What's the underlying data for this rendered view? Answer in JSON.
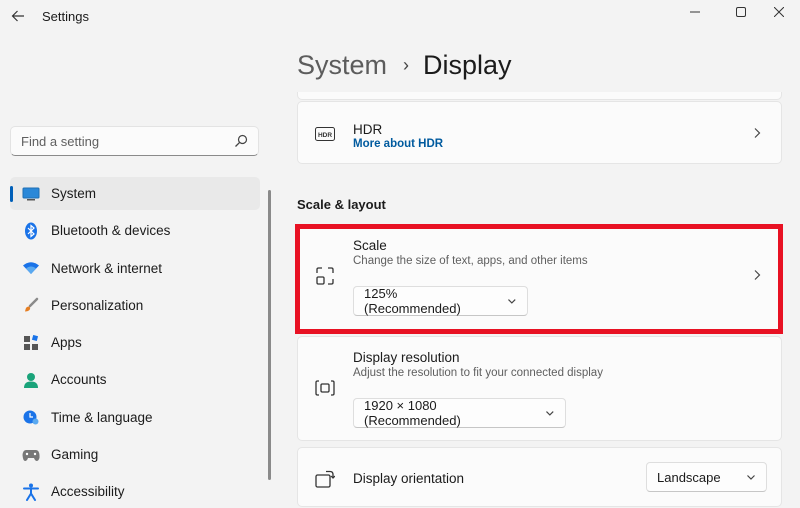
{
  "window": {
    "title": "Settings",
    "controls": {
      "minimize": "—",
      "maximize": "☐",
      "close": "✕"
    }
  },
  "search": {
    "placeholder": "Find a setting"
  },
  "sidebar": {
    "items": [
      {
        "label": "System",
        "icon": "monitor-icon",
        "active": true
      },
      {
        "label": "Bluetooth & devices",
        "icon": "bluetooth-icon"
      },
      {
        "label": "Network & internet",
        "icon": "wifi-icon"
      },
      {
        "label": "Personalization",
        "icon": "brush-icon"
      },
      {
        "label": "Apps",
        "icon": "apps-icon"
      },
      {
        "label": "Accounts",
        "icon": "person-icon"
      },
      {
        "label": "Time & language",
        "icon": "clock-globe-icon"
      },
      {
        "label": "Gaming",
        "icon": "gamepad-icon"
      },
      {
        "label": "Accessibility",
        "icon": "accessibility-icon"
      }
    ]
  },
  "header": {
    "parent": "System",
    "separator": "›",
    "current": "Display"
  },
  "hdr": {
    "title": "HDR",
    "link": "More about HDR",
    "icon_text": "HDR"
  },
  "section": {
    "scale_layout": "Scale & layout"
  },
  "scale": {
    "title": "Scale",
    "subtitle": "Change the size of text, apps, and other items",
    "value": "125% (Recommended)"
  },
  "resolution": {
    "title": "Display resolution",
    "subtitle": "Adjust the resolution to fit your connected display",
    "value": "1920 × 1080 (Recommended)"
  },
  "orientation": {
    "title": "Display orientation",
    "value": "Landscape"
  },
  "colors": {
    "accent": "#005fb8",
    "highlight": "#e81123",
    "link": "#005a9e"
  }
}
